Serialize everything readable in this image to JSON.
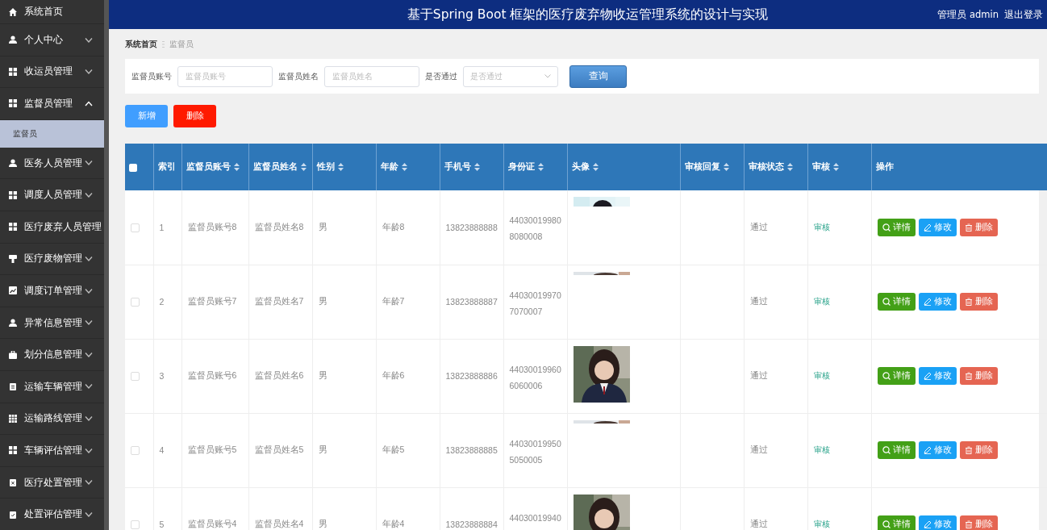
{
  "sidebar": {
    "items": [
      {
        "label": "系统首页",
        "kind": "link"
      },
      {
        "label": "个人中心",
        "kind": "menu",
        "expanded": false
      },
      {
        "label": "收运员管理",
        "kind": "menu",
        "expanded": false
      },
      {
        "label": "监督员管理",
        "kind": "menu",
        "expanded": true,
        "children": [
          {
            "label": "监督员",
            "selected": true
          }
        ]
      },
      {
        "label": "医务人员管理",
        "kind": "menu",
        "expanded": false
      },
      {
        "label": "调度人员管理",
        "kind": "menu",
        "expanded": false
      },
      {
        "label": "医疗废弃人员管理",
        "kind": "link"
      },
      {
        "label": "医疗废物管理",
        "kind": "menu",
        "expanded": false
      },
      {
        "label": "调度订单管理",
        "kind": "menu",
        "expanded": false
      },
      {
        "label": "异常信息管理",
        "kind": "menu",
        "expanded": false
      },
      {
        "label": "划分信息管理",
        "kind": "menu",
        "expanded": false
      },
      {
        "label": "运输车辆管理",
        "kind": "menu",
        "expanded": false
      },
      {
        "label": "运输路线管理",
        "kind": "menu",
        "expanded": false
      },
      {
        "label": "车辆评估管理",
        "kind": "menu",
        "expanded": false
      },
      {
        "label": "医疗处置管理",
        "kind": "menu",
        "expanded": false
      },
      {
        "label": "处置评估管理",
        "kind": "menu",
        "expanded": false
      }
    ]
  },
  "header": {
    "title": "基于Spring Boot 框架的医疗废弃物收运管理系统的设计与实现",
    "user": "管理员 admin",
    "logout": "退出登录"
  },
  "breadcrumb": [
    "系统首页",
    "监督员"
  ],
  "search": {
    "fields": [
      {
        "label": "监督员账号",
        "kind": "text",
        "placeholder": "监督员账号"
      },
      {
        "label": "监督员姓名",
        "kind": "text",
        "placeholder": "监督员姓名"
      },
      {
        "label": "是否通过",
        "kind": "select",
        "placeholder": "是否通过"
      }
    ],
    "button": "查询"
  },
  "actions": [
    {
      "label": "新增",
      "kind": "add"
    },
    {
      "label": "删除",
      "kind": "delete"
    }
  ],
  "table": {
    "columns": [
      {
        "label": "索引",
        "sortable": false
      },
      {
        "label": "监督员账号",
        "sortable": true
      },
      {
        "label": "监督员姓名",
        "sortable": true
      },
      {
        "label": "性别",
        "sortable": true
      },
      {
        "label": "年龄",
        "sortable": true
      },
      {
        "label": "手机号",
        "sortable": true
      },
      {
        "label": "身份证",
        "sortable": true
      },
      {
        "label": "头像",
        "sortable": true
      },
      {
        "label": "审核回复",
        "sortable": true
      },
      {
        "label": "审核状态",
        "sortable": true
      },
      {
        "label": "审核",
        "sortable": true
      },
      {
        "label": "操作",
        "sortable": false
      }
    ],
    "select_all": {
      "checked": false
    },
    "rows": [
      {
        "selected": false,
        "index": "1",
        "account": "监督员账号8",
        "name": "监督员姓名8",
        "gender": "男",
        "age": "年龄8",
        "phone": "13823888888",
        "id_card": "440300199808080008",
        "avatar": {
          "kind": "strip"
        },
        "status": "通过",
        "review": "审核",
        "buttons": [
          {
            "label": "详情",
            "kind": "detail"
          },
          {
            "label": "修改",
            "kind": "edit"
          },
          {
            "label": "删除",
            "kind": "delete"
          }
        ]
      },
      {
        "selected": false,
        "index": "2",
        "account": "监督员账号7",
        "name": "监督员姓名7",
        "gender": "男",
        "age": "年龄7",
        "phone": "13823888887",
        "id_card": "440300199707070007",
        "avatar": {
          "kind": "line"
        },
        "status": "通过",
        "review": "审核",
        "buttons": [
          {
            "label": "详情",
            "kind": "detail"
          },
          {
            "label": "修改",
            "kind": "edit"
          },
          {
            "label": "删除",
            "kind": "delete"
          }
        ]
      },
      {
        "selected": false,
        "index": "3",
        "account": "监督员账号6",
        "name": "监督员姓名6",
        "gender": "男",
        "age": "年龄6",
        "phone": "13823888886",
        "id_card": "440300199606060006",
        "status": "通过",
        "review": "审核",
        "buttons": [
          {
            "label": "详情",
            "kind": "detail"
          },
          {
            "label": "修改",
            "kind": "edit"
          },
          {
            "label": "删除",
            "kind": "delete"
          }
        ]
      },
      {
        "selected": false,
        "index": "4",
        "account": "监督员账号5",
        "name": "监督员姓名5",
        "gender": "男",
        "age": "年龄5",
        "phone": "13823888885",
        "id_card": "440300199505050005",
        "avatar": {
          "kind": "line"
        },
        "status": "通过",
        "review": "审核",
        "buttons": [
          {
            "label": "详情",
            "kind": "detail"
          },
          {
            "label": "修改",
            "kind": "edit"
          },
          {
            "label": "删除",
            "kind": "delete"
          }
        ]
      },
      {
        "selected": false,
        "index": "5",
        "account": "监督员账号4",
        "name": "监督员姓名4",
        "gender": "男",
        "age": "年龄4",
        "phone": "13823888884",
        "id_card": "44030019940",
        "status": "通过",
        "review": "审核",
        "buttons": [
          {
            "label": "详情",
            "kind": "detail"
          },
          {
            "label": "修改",
            "kind": "edit"
          },
          {
            "label": "删除",
            "kind": "delete"
          }
        ]
      }
    ]
  }
}
